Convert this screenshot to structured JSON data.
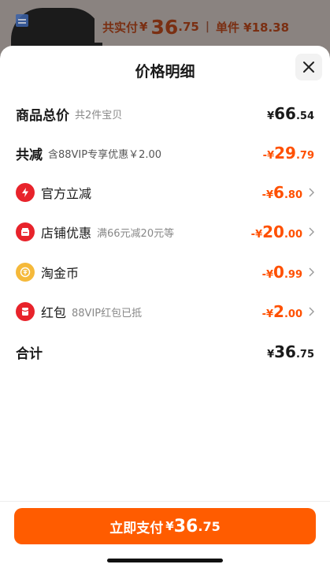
{
  "header_bg": {
    "total_label": "共实付",
    "currency": "¥",
    "total_int": "36",
    "total_dec": ".75",
    "separator": "|",
    "unit_price": "单件 ¥18.38"
  },
  "sheet": {
    "title": "价格明细",
    "close_icon": "close-icon"
  },
  "rows": {
    "goods_total": {
      "label": "商品总价",
      "note": "共2件宝贝",
      "sym": "¥",
      "int": "66",
      "dec": ".54"
    },
    "total_reduction": {
      "label": "共减",
      "note": "含88VIP专享优惠￥2.00",
      "sym": "-¥",
      "int": "29",
      "dec": ".79"
    },
    "official": {
      "label": "官方立减",
      "icon": "lightning-icon",
      "sym": "-¥",
      "int": "6",
      "dec": ".80"
    },
    "store": {
      "label": "店铺优惠",
      "note": "满66元减20元等",
      "icon": "shop-icon",
      "sym": "-¥",
      "int": "20",
      "dec": ".00"
    },
    "taojinbi": {
      "label": "淘金币",
      "icon": "coin-icon",
      "sym": "-¥",
      "int": "0",
      "dec": ".99"
    },
    "hongbao": {
      "label": "红包",
      "note": "88VIP红包已抵",
      "icon": "red-envelope-icon",
      "sym": "-¥",
      "int": "2",
      "dec": ".00"
    },
    "sum": {
      "label": "合计",
      "sym": "¥",
      "int": "36",
      "dec": ".75"
    }
  },
  "pay_button": {
    "label": "立即支付",
    "sym": "¥",
    "int": "36",
    "dec": ".75"
  },
  "colors": {
    "accent": "#ff5000",
    "button": "#ff5c00",
    "icon_red": "#e8232b",
    "icon_gold": "#f5b93a"
  }
}
